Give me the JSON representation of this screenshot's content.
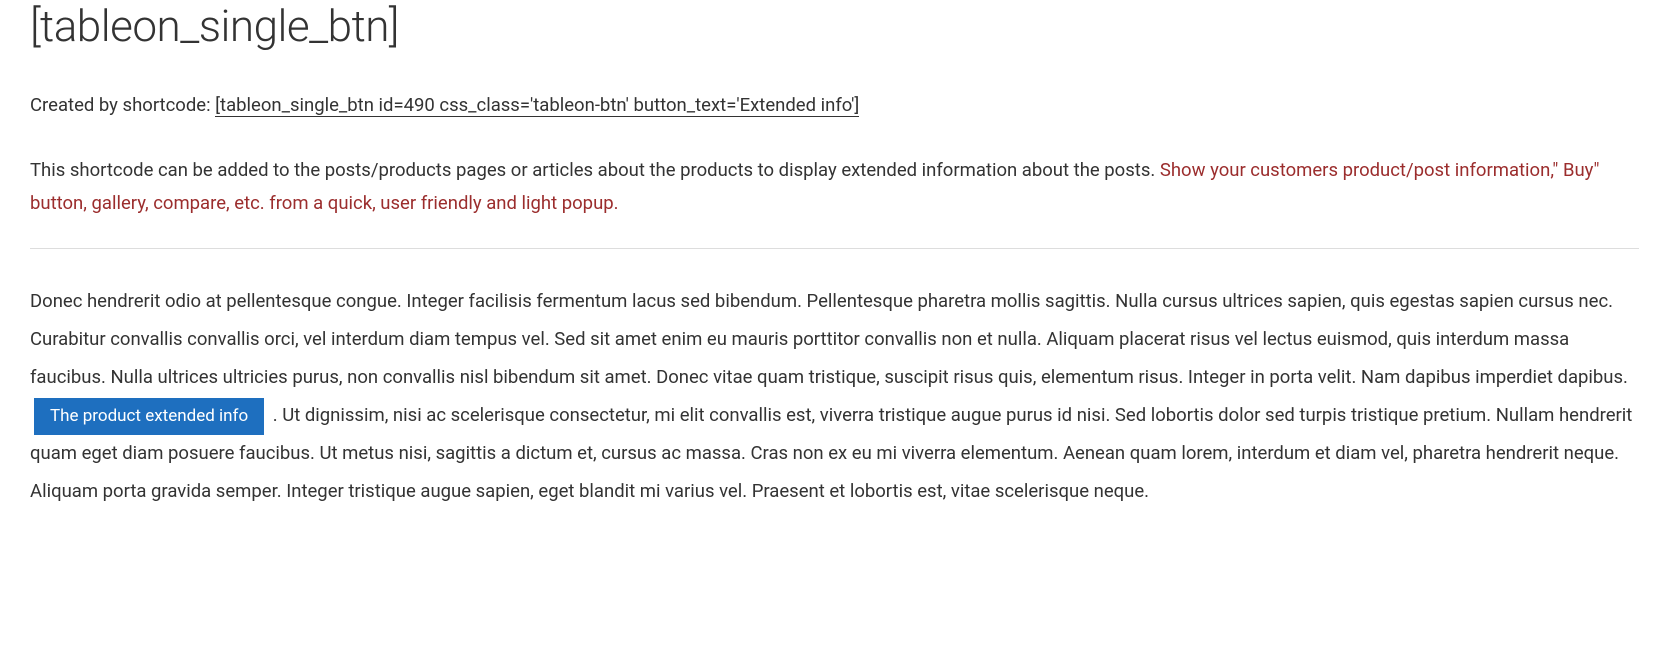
{
  "title": "[tableon_single_btn]",
  "intro": {
    "prefix": "Created by shortcode: ",
    "shortcode": "[tableon_single_btn id=490 css_class='tableon-btn' button_text='Extended info']"
  },
  "description": {
    "lead": "This shortcode can be added to the posts/products pages or articles about the products to display extended information about the posts. ",
    "callout": "Show your customers product/post information,\" Buy\" button, gallery, compare, etc. from a quick, user friendly and light popup."
  },
  "body": {
    "before_button": "Donec hendrerit odio at pellentesque congue. Integer facilisis fermentum lacus sed bibendum. Pellentesque pharetra mollis sagittis. Nulla cursus ultrices sapien, quis egestas sapien cursus nec. Curabitur convallis convallis orci, vel interdum diam tempus vel. Sed sit amet enim eu mauris porttitor convallis non et nulla. Aliquam placerat risus vel lectus euismod, quis interdum massa faucibus. Nulla ultrices ultricies purus, non convallis nisl bibendum sit amet. Donec vitae quam tristique, suscipit risus quis, elementum risus. Integer in porta velit. Nam dapibus imperdiet dapibus. ",
    "button_label": "The product extended info",
    "after_button": " . Ut dignissim, nisi ac scelerisque consectetur, mi elit convallis est, viverra tristique augue purus id nisi. Sed lobortis dolor sed turpis tristique pretium. Nullam hendrerit quam eget diam posuere faucibus. Ut metus nisi, sagittis a dictum et, cursus ac massa. Cras non ex eu mi viverra elementum. Aenean quam lorem, interdum et diam vel, pharetra hendrerit neque. Aliquam porta gravida semper. Integer tristique augue sapien, eget blandit mi varius vel. Praesent et lobortis est, vitae scelerisque neque."
  }
}
